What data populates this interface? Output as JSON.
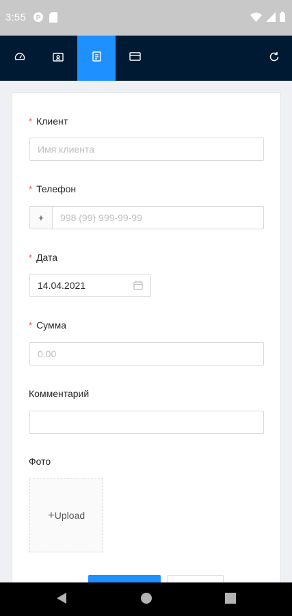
{
  "status_bar": {
    "time": "3:55",
    "left_icons": [
      "notification-p-icon",
      "sd-card-icon"
    ],
    "right_icons": [
      "wifi-icon",
      "cell-signal-icon",
      "battery-icon"
    ]
  },
  "nav": {
    "tabs": [
      {
        "icon": "dashboard-icon",
        "active": false
      },
      {
        "icon": "id-card-icon",
        "active": false
      },
      {
        "icon": "document-icon",
        "active": true
      },
      {
        "icon": "credit-card-icon",
        "active": false
      }
    ],
    "refresh_icon": "refresh-icon",
    "active_color": "#1e90ff",
    "bar_color": "#011a33"
  },
  "form": {
    "client": {
      "label": "Клиент",
      "required": "*",
      "placeholder": "Имя клиента",
      "value": ""
    },
    "phone": {
      "label": "Телефон",
      "required": "*",
      "prefix": "+",
      "placeholder": "998 (99) 999-99-99",
      "value": ""
    },
    "date": {
      "label": "Дата",
      "required": "*",
      "value": "14.04.2021"
    },
    "amount": {
      "label": "Сумма",
      "required": "*",
      "placeholder": "0.00",
      "value": ""
    },
    "comment": {
      "label": "Комментарий",
      "value": ""
    },
    "photo": {
      "label": "Фото",
      "upload_label": "Upload",
      "plus": "+"
    }
  },
  "android_nav": [
    "back-icon",
    "home-icon",
    "recents-icon"
  ]
}
